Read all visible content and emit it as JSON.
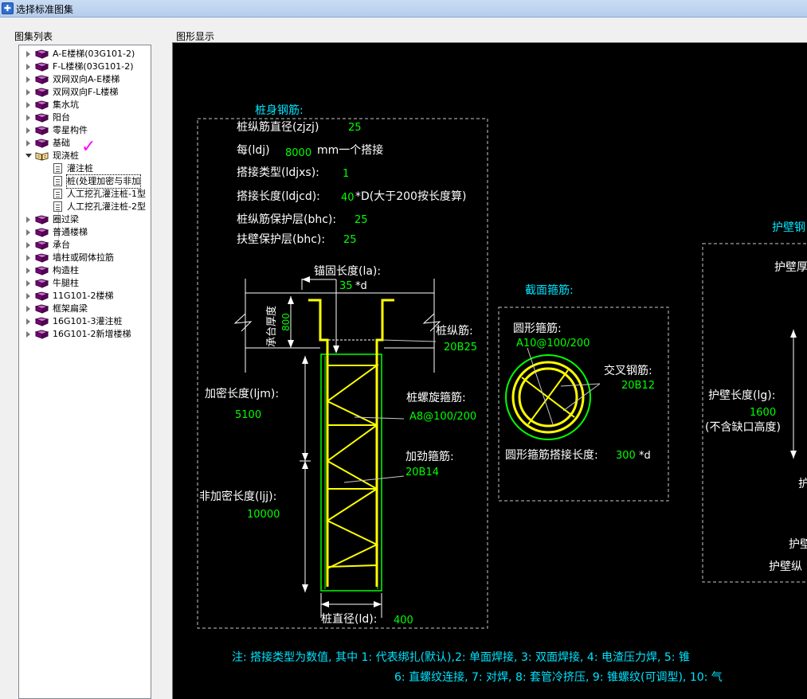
{
  "window": {
    "title": "选择标准图集"
  },
  "labels": {
    "list": "图集列表",
    "view": "图形显示"
  },
  "tree": [
    {
      "label": "A-E楼梯(03G101-2)"
    },
    {
      "label": "F-L楼梯(03G101-2)"
    },
    {
      "label": "双网双向A-E楼梯"
    },
    {
      "label": "双网双向F-L楼梯"
    },
    {
      "label": "集水坑"
    },
    {
      "label": "阳台"
    },
    {
      "label": "零星构件"
    },
    {
      "label": "基础"
    },
    {
      "label": "现浇桩",
      "children": [
        {
          "label": "灌注桩"
        },
        {
          "label": "桩(处理加密与非加"
        },
        {
          "label": "人工挖孔灌注桩-1型"
        },
        {
          "label": "人工挖孔灌注桩-2型"
        }
      ]
    },
    {
      "label": "圈过梁"
    },
    {
      "label": "普通楼梯"
    },
    {
      "label": "承台"
    },
    {
      "label": "墙柱或砌体拉筋"
    },
    {
      "label": "构造柱"
    },
    {
      "label": "牛腿柱"
    },
    {
      "label": "11G101-2楼梯"
    },
    {
      "label": "框架扁梁"
    },
    {
      "label": "16G101-3灌注桩"
    },
    {
      "label": "16G101-2新增楼梯"
    }
  ],
  "drawing": {
    "pile_title": "桩身钢筋:",
    "zjzj_label": "桩纵筋直径(zjzj)",
    "zjzj_value": "25",
    "ldj_label": "每(ldj)",
    "ldj_value": "8000",
    "ldj_suffix": "mm一个搭接",
    "ldjxs_label": "搭接类型(ldjxs):",
    "ldjxs_value": "1",
    "ldjcd_label": "搭接长度(ldjcd):",
    "ldjcd_value": "40",
    "ldjcd_suffix": "*D(大于200按长度算)",
    "bhc_label": "桩纵筋保护层(bhc):",
    "bhc_value": "25",
    "fbbhc_label": "扶壁保护层(bhc):",
    "fbbhc_value": "25",
    "la_label": "锚固长度(la):",
    "la_value": "35",
    "la_suffix": "*d",
    "cap_label": "承台厚度",
    "cap_value": "800",
    "long_bar_label": "桩纵筋:",
    "long_bar_value": "20B25",
    "ljm_label": "加密长度(ljm):",
    "ljm_value": "5100",
    "spiral_label": "桩螺旋箍筋:",
    "spiral_value": "A8@100/200",
    "stiff_label": "加劲箍筋:",
    "stiff_value": "20B14",
    "ljj_label": "非加密长度(ljj):",
    "ljj_value": "10000",
    "ld_label": "桩直径(ld):",
    "ld_value": "400",
    "section_title": "截面箍筋:",
    "circle_label": "圆形箍筋:",
    "circle_value": "A10@100/200",
    "cross_label": "交叉钢筋:",
    "cross_value": "20B12",
    "overlap_label": "圆形箍筋搭接长度:",
    "overlap_value": "300",
    "overlap_suffix": "*d",
    "wall_title": "护壁钢",
    "wall_thick": "护壁厚",
    "wall_len_label": "护壁长度(lg):",
    "wall_len_value": "1600",
    "wall_len_note": "(不含缺口高度)",
    "wall_p1": "护",
    "wall_p2": "护壁",
    "wall_p3": "护壁纵",
    "note_line1": "注: 搭接类型为数值, 其中 1: 代表绑扎(默认),2: 单面焊接, 3: 双面焊接, 4: 电渣压力焊, 5: 锥",
    "note_line2": "6: 直螺纹连接, 7: 对焊, 8: 套管冷挤压, 9: 锥螺纹(可调型), 10: 气"
  },
  "colors": {
    "white": "#ffffff",
    "green": "#00ff00",
    "cyan": "#00e5ff",
    "yellow": "#ffff00",
    "gray": "#c8c8c8"
  }
}
